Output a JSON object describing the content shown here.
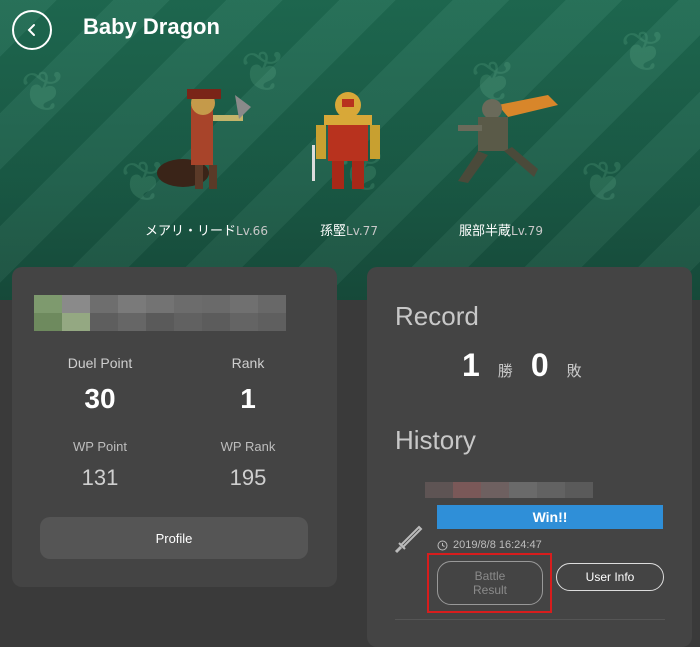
{
  "header": {
    "title": "Baby Dragon"
  },
  "team": [
    {
      "name": "メアリ・リード",
      "level": "Lv.66",
      "icon": "pirate-character-sprite"
    },
    {
      "name": "孫堅",
      "level": "Lv.77",
      "icon": "armored-warrior-sprite"
    },
    {
      "name": "服部半蔵",
      "level": "Lv.79",
      "icon": "ninja-character-sprite"
    }
  ],
  "player": {
    "duel_point_label": "Duel Point",
    "duel_point_value": "30",
    "rank_label": "Rank",
    "rank_value": "1",
    "wp_point_label": "WP Point",
    "wp_point_value": "131",
    "wp_rank_label": "WP Rank",
    "wp_rank_value": "195",
    "profile_button": "Profile"
  },
  "record": {
    "title": "Record",
    "wins": "1",
    "wins_unit": "勝",
    "losses": "0",
    "losses_unit": "敗"
  },
  "history": {
    "title": "History",
    "result": "Win!!",
    "timestamp": "2019/8/8 16:24:47",
    "battle_result_button": "Battle\nResult",
    "user_info_button": "User Info"
  },
  "colors": {
    "win_bar": "#2f8fd8",
    "highlight": "#d81d1d",
    "hero_bg": "#1f6b52"
  }
}
